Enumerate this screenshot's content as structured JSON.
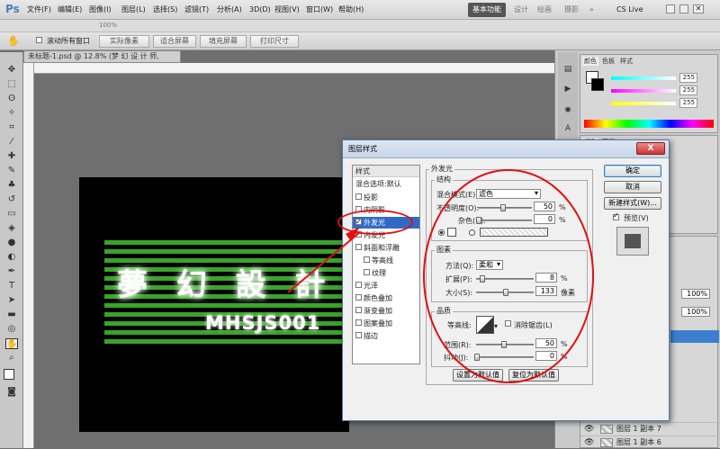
{
  "app": {
    "logo": "Ps",
    "zoom": "100%"
  },
  "menu": [
    "文件(F)",
    "编辑(E)",
    "图像(I)",
    "图层(L)",
    "选择(S)",
    "滤镜(T)",
    "分析(A)",
    "3D(D)",
    "视图(V)",
    "窗口(W)",
    "帮助(H)"
  ],
  "workspaces": [
    "基本功能",
    "设计",
    "绘画",
    "摄影",
    "»"
  ],
  "cslive": "CS Live",
  "options_bar": {
    "scroll_all": "滚动所有窗口",
    "buttons": [
      "实际像素",
      "适合屏幕",
      "填充屏幕",
      "打印尺寸"
    ]
  },
  "document_tab": "未标题-1.psd @ 12.8% (梦 幻 设 计 师, RGB/8)",
  "canvas": {
    "title": "夢 幻 設 計",
    "subtitle": "MHSJS001"
  },
  "color_panel": {
    "tabs": [
      "颜色",
      "色板",
      "样式"
    ],
    "values": [
      "255",
      "255",
      "255"
    ]
  },
  "side_tabs": [
    "调整",
    "蒙版"
  ],
  "layers_panel": {
    "opacity": "100%",
    "fill": "100%",
    "layers": [
      "图层 1 副本 7",
      "图层 1 副本 6"
    ]
  },
  "dialog": {
    "title": "图层样式",
    "close": "X",
    "styles_header": "样式",
    "blend_defaults": "混合选项:默认",
    "style_items": [
      {
        "label": "投影",
        "checked": false
      },
      {
        "label": "内阴影",
        "checked": false
      },
      {
        "label": "外发光",
        "checked": true
      },
      {
        "label": "内发光",
        "checked": false
      },
      {
        "label": "斜面和浮雕",
        "checked": false
      },
      {
        "label": "等高线",
        "checked": false
      },
      {
        "label": "纹理",
        "checked": false
      },
      {
        "label": "光泽",
        "checked": false
      },
      {
        "label": "颜色叠加",
        "checked": false
      },
      {
        "label": "渐变叠加",
        "checked": false
      },
      {
        "label": "图案叠加",
        "checked": false
      },
      {
        "label": "描边",
        "checked": false
      }
    ],
    "section_title": "外发光",
    "structure": {
      "label": "结构",
      "blend_mode_label": "混合模式(E):",
      "blend_mode_value": "滤色",
      "opacity_label": "不透明度(O):",
      "opacity_value": "50",
      "noise_label": "杂色(N):",
      "noise_value": "0",
      "unit": "%"
    },
    "elements": {
      "label": "图素",
      "method_label": "方法(Q):",
      "method_value": "柔和",
      "spread_label": "扩展(P):",
      "spread_value": "8",
      "size_label": "大小(S):",
      "size_value": "133",
      "size_unit": "像素",
      "unit": "%"
    },
    "quality": {
      "label": "品质",
      "contour_label": "等高线:",
      "antialias_label": "消除锯齿(L)",
      "range_label": "范围(R):",
      "range_value": "50",
      "jitter_label": "抖动(J):",
      "jitter_value": "0",
      "unit": "%"
    },
    "make_default": "设置为默认值",
    "reset_default": "复位为默认值",
    "ok": "确定",
    "cancel": "取消",
    "new_style": "新建样式(W)...",
    "preview": "预览(V)"
  }
}
